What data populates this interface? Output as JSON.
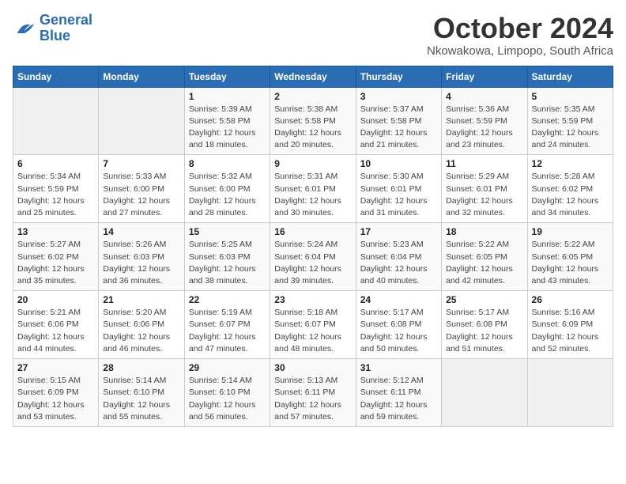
{
  "header": {
    "logo_line1": "General",
    "logo_line2": "Blue",
    "month": "October 2024",
    "location": "Nkowakowa, Limpopo, South Africa"
  },
  "days_of_week": [
    "Sunday",
    "Monday",
    "Tuesday",
    "Wednesday",
    "Thursday",
    "Friday",
    "Saturday"
  ],
  "weeks": [
    [
      {
        "day": "",
        "sunrise": "",
        "sunset": "",
        "daylight": ""
      },
      {
        "day": "",
        "sunrise": "",
        "sunset": "",
        "daylight": ""
      },
      {
        "day": "1",
        "sunrise": "Sunrise: 5:39 AM",
        "sunset": "Sunset: 5:58 PM",
        "daylight": "Daylight: 12 hours and 18 minutes."
      },
      {
        "day": "2",
        "sunrise": "Sunrise: 5:38 AM",
        "sunset": "Sunset: 5:58 PM",
        "daylight": "Daylight: 12 hours and 20 minutes."
      },
      {
        "day": "3",
        "sunrise": "Sunrise: 5:37 AM",
        "sunset": "Sunset: 5:58 PM",
        "daylight": "Daylight: 12 hours and 21 minutes."
      },
      {
        "day": "4",
        "sunrise": "Sunrise: 5:36 AM",
        "sunset": "Sunset: 5:59 PM",
        "daylight": "Daylight: 12 hours and 23 minutes."
      },
      {
        "day": "5",
        "sunrise": "Sunrise: 5:35 AM",
        "sunset": "Sunset: 5:59 PM",
        "daylight": "Daylight: 12 hours and 24 minutes."
      }
    ],
    [
      {
        "day": "6",
        "sunrise": "Sunrise: 5:34 AM",
        "sunset": "Sunset: 5:59 PM",
        "daylight": "Daylight: 12 hours and 25 minutes."
      },
      {
        "day": "7",
        "sunrise": "Sunrise: 5:33 AM",
        "sunset": "Sunset: 6:00 PM",
        "daylight": "Daylight: 12 hours and 27 minutes."
      },
      {
        "day": "8",
        "sunrise": "Sunrise: 5:32 AM",
        "sunset": "Sunset: 6:00 PM",
        "daylight": "Daylight: 12 hours and 28 minutes."
      },
      {
        "day": "9",
        "sunrise": "Sunrise: 5:31 AM",
        "sunset": "Sunset: 6:01 PM",
        "daylight": "Daylight: 12 hours and 30 minutes."
      },
      {
        "day": "10",
        "sunrise": "Sunrise: 5:30 AM",
        "sunset": "Sunset: 6:01 PM",
        "daylight": "Daylight: 12 hours and 31 minutes."
      },
      {
        "day": "11",
        "sunrise": "Sunrise: 5:29 AM",
        "sunset": "Sunset: 6:01 PM",
        "daylight": "Daylight: 12 hours and 32 minutes."
      },
      {
        "day": "12",
        "sunrise": "Sunrise: 5:28 AM",
        "sunset": "Sunset: 6:02 PM",
        "daylight": "Daylight: 12 hours and 34 minutes."
      }
    ],
    [
      {
        "day": "13",
        "sunrise": "Sunrise: 5:27 AM",
        "sunset": "Sunset: 6:02 PM",
        "daylight": "Daylight: 12 hours and 35 minutes."
      },
      {
        "day": "14",
        "sunrise": "Sunrise: 5:26 AM",
        "sunset": "Sunset: 6:03 PM",
        "daylight": "Daylight: 12 hours and 36 minutes."
      },
      {
        "day": "15",
        "sunrise": "Sunrise: 5:25 AM",
        "sunset": "Sunset: 6:03 PM",
        "daylight": "Daylight: 12 hours and 38 minutes."
      },
      {
        "day": "16",
        "sunrise": "Sunrise: 5:24 AM",
        "sunset": "Sunset: 6:04 PM",
        "daylight": "Daylight: 12 hours and 39 minutes."
      },
      {
        "day": "17",
        "sunrise": "Sunrise: 5:23 AM",
        "sunset": "Sunset: 6:04 PM",
        "daylight": "Daylight: 12 hours and 40 minutes."
      },
      {
        "day": "18",
        "sunrise": "Sunrise: 5:22 AM",
        "sunset": "Sunset: 6:05 PM",
        "daylight": "Daylight: 12 hours and 42 minutes."
      },
      {
        "day": "19",
        "sunrise": "Sunrise: 5:22 AM",
        "sunset": "Sunset: 6:05 PM",
        "daylight": "Daylight: 12 hours and 43 minutes."
      }
    ],
    [
      {
        "day": "20",
        "sunrise": "Sunrise: 5:21 AM",
        "sunset": "Sunset: 6:06 PM",
        "daylight": "Daylight: 12 hours and 44 minutes."
      },
      {
        "day": "21",
        "sunrise": "Sunrise: 5:20 AM",
        "sunset": "Sunset: 6:06 PM",
        "daylight": "Daylight: 12 hours and 46 minutes."
      },
      {
        "day": "22",
        "sunrise": "Sunrise: 5:19 AM",
        "sunset": "Sunset: 6:07 PM",
        "daylight": "Daylight: 12 hours and 47 minutes."
      },
      {
        "day": "23",
        "sunrise": "Sunrise: 5:18 AM",
        "sunset": "Sunset: 6:07 PM",
        "daylight": "Daylight: 12 hours and 48 minutes."
      },
      {
        "day": "24",
        "sunrise": "Sunrise: 5:17 AM",
        "sunset": "Sunset: 6:08 PM",
        "daylight": "Daylight: 12 hours and 50 minutes."
      },
      {
        "day": "25",
        "sunrise": "Sunrise: 5:17 AM",
        "sunset": "Sunset: 6:08 PM",
        "daylight": "Daylight: 12 hours and 51 minutes."
      },
      {
        "day": "26",
        "sunrise": "Sunrise: 5:16 AM",
        "sunset": "Sunset: 6:09 PM",
        "daylight": "Daylight: 12 hours and 52 minutes."
      }
    ],
    [
      {
        "day": "27",
        "sunrise": "Sunrise: 5:15 AM",
        "sunset": "Sunset: 6:09 PM",
        "daylight": "Daylight: 12 hours and 53 minutes."
      },
      {
        "day": "28",
        "sunrise": "Sunrise: 5:14 AM",
        "sunset": "Sunset: 6:10 PM",
        "daylight": "Daylight: 12 hours and 55 minutes."
      },
      {
        "day": "29",
        "sunrise": "Sunrise: 5:14 AM",
        "sunset": "Sunset: 6:10 PM",
        "daylight": "Daylight: 12 hours and 56 minutes."
      },
      {
        "day": "30",
        "sunrise": "Sunrise: 5:13 AM",
        "sunset": "Sunset: 6:11 PM",
        "daylight": "Daylight: 12 hours and 57 minutes."
      },
      {
        "day": "31",
        "sunrise": "Sunrise: 5:12 AM",
        "sunset": "Sunset: 6:11 PM",
        "daylight": "Daylight: 12 hours and 59 minutes."
      },
      {
        "day": "",
        "sunrise": "",
        "sunset": "",
        "daylight": ""
      },
      {
        "day": "",
        "sunrise": "",
        "sunset": "",
        "daylight": ""
      }
    ]
  ]
}
